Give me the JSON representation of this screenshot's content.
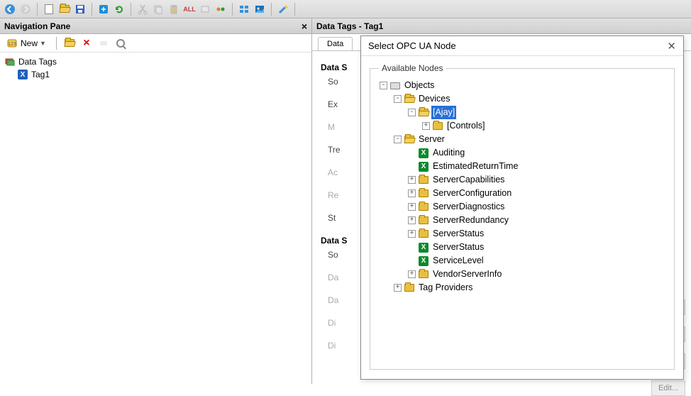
{
  "toolbar": {
    "icons": [
      "back",
      "forward",
      "new-doc",
      "open",
      "save",
      "export",
      "refresh",
      "cut",
      "copy",
      "paste",
      "paste-all",
      "format",
      "link",
      "image",
      "wizard"
    ]
  },
  "nav_pane": {
    "title": "Navigation Pane",
    "new_label": "New",
    "root": "Data Tags",
    "children": [
      "Tag1"
    ]
  },
  "right": {
    "title": "Data Tags - Tag1",
    "tab": "Data",
    "sections": [
      {
        "title": "Data S",
        "fields": [
          {
            "label": "So",
            "dim": false
          },
          {
            "label": "Ex",
            "dim": false
          },
          {
            "label": "M",
            "dim": true
          },
          {
            "label": "Tre",
            "dim": false
          },
          {
            "label": "Ac",
            "dim": true
          },
          {
            "label": "Re",
            "dim": true
          },
          {
            "label": "St",
            "dim": false
          }
        ]
      },
      {
        "title": "Data S",
        "fields": [
          {
            "label": "So",
            "dim": false
          },
          {
            "label": "Da",
            "dim": true
          },
          {
            "label": "Da",
            "dim": true
          },
          {
            "label": "Di",
            "dim": true
          },
          {
            "label": "Di",
            "dim": true
          }
        ]
      }
    ],
    "edit_label": "Edit..."
  },
  "dialog": {
    "title": "Select OPC UA Node",
    "group_label": "Available Nodes",
    "tree": [
      {
        "d": 0,
        "exp": "-",
        "icon": "obj",
        "label": "Objects"
      },
      {
        "d": 1,
        "exp": "-",
        "icon": "folder-open",
        "label": "Devices"
      },
      {
        "d": 2,
        "exp": "-",
        "icon": "folder-open",
        "label": "[Ajay]",
        "selected": true
      },
      {
        "d": 3,
        "exp": "+",
        "icon": "folder",
        "label": "[Controls]"
      },
      {
        "d": 1,
        "exp": "-",
        "icon": "folder-open",
        "label": "Server"
      },
      {
        "d": 2,
        "exp": "",
        "icon": "x",
        "label": "Auditing"
      },
      {
        "d": 2,
        "exp": "",
        "icon": "x",
        "label": "EstimatedReturnTime"
      },
      {
        "d": 2,
        "exp": "+",
        "icon": "folder",
        "label": "ServerCapabilities"
      },
      {
        "d": 2,
        "exp": "+",
        "icon": "folder",
        "label": "ServerConfiguration"
      },
      {
        "d": 2,
        "exp": "+",
        "icon": "folder",
        "label": "ServerDiagnostics"
      },
      {
        "d": 2,
        "exp": "+",
        "icon": "folder",
        "label": "ServerRedundancy"
      },
      {
        "d": 2,
        "exp": "+",
        "icon": "folder",
        "label": "ServerStatus"
      },
      {
        "d": 2,
        "exp": "",
        "icon": "x",
        "label": "ServerStatus"
      },
      {
        "d": 2,
        "exp": "",
        "icon": "x",
        "label": "ServiceLevel"
      },
      {
        "d": 2,
        "exp": "+",
        "icon": "folder",
        "label": "VendorServerInfo"
      },
      {
        "d": 1,
        "exp": "+",
        "icon": "folder",
        "label": "Tag Providers"
      }
    ]
  }
}
